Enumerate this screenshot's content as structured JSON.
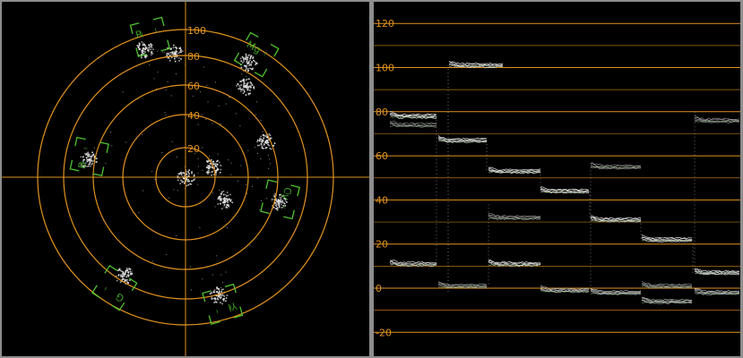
{
  "colors": {
    "graticule": "#e0921f",
    "target_box": "#4fc22f",
    "trace": "#e6e6e6",
    "background": "#000000",
    "frame": "#8d8d8d"
  },
  "vectorscope": {
    "ring_labels": [
      "20",
      "40",
      "60",
      "80",
      "100"
    ],
    "target_letters": [
      "R",
      "Mg",
      "B",
      "Cy",
      "G",
      "Yl"
    ]
  },
  "waveform": {
    "scale_labels": [
      "120",
      "100",
      "80",
      "60",
      "40",
      "20",
      "0",
      "-20"
    ]
  },
  "chart_data": [
    {
      "type": "scatter",
      "title": "",
      "rings": [
        20,
        40,
        60,
        80,
        100
      ],
      "clusters": [
        {
          "x": -28,
          "y": 87
        },
        {
          "x": -8,
          "y": 84
        },
        {
          "x": 42,
          "y": 78
        },
        {
          "x": 40,
          "y": 62
        },
        {
          "x": -66,
          "y": 12
        },
        {
          "x": 54,
          "y": 24
        },
        {
          "x": 62,
          "y": -16
        },
        {
          "x": -42,
          "y": -66
        },
        {
          "x": 22,
          "y": -80
        },
        {
          "x": 0,
          "y": 0
        },
        {
          "x": 26,
          "y": -15
        },
        {
          "x": 18,
          "y": 7
        }
      ]
    },
    {
      "type": "line",
      "title": "",
      "ylim": [
        -25,
        125
      ],
      "y_ticks": [
        -20,
        0,
        20,
        40,
        60,
        80,
        100,
        120
      ],
      "bars": [
        "white",
        "yellow",
        "cyan",
        "green",
        "magenta",
        "red",
        "blue",
        "black"
      ],
      "series": [
        {
          "values": [
            78,
            101,
            67,
            53,
            44,
            31,
            22,
            7
          ]
        },
        {
          "values": [
            11,
            1,
            11,
            -1,
            31,
            -2,
            -6,
            7
          ]
        }
      ]
    }
  ]
}
